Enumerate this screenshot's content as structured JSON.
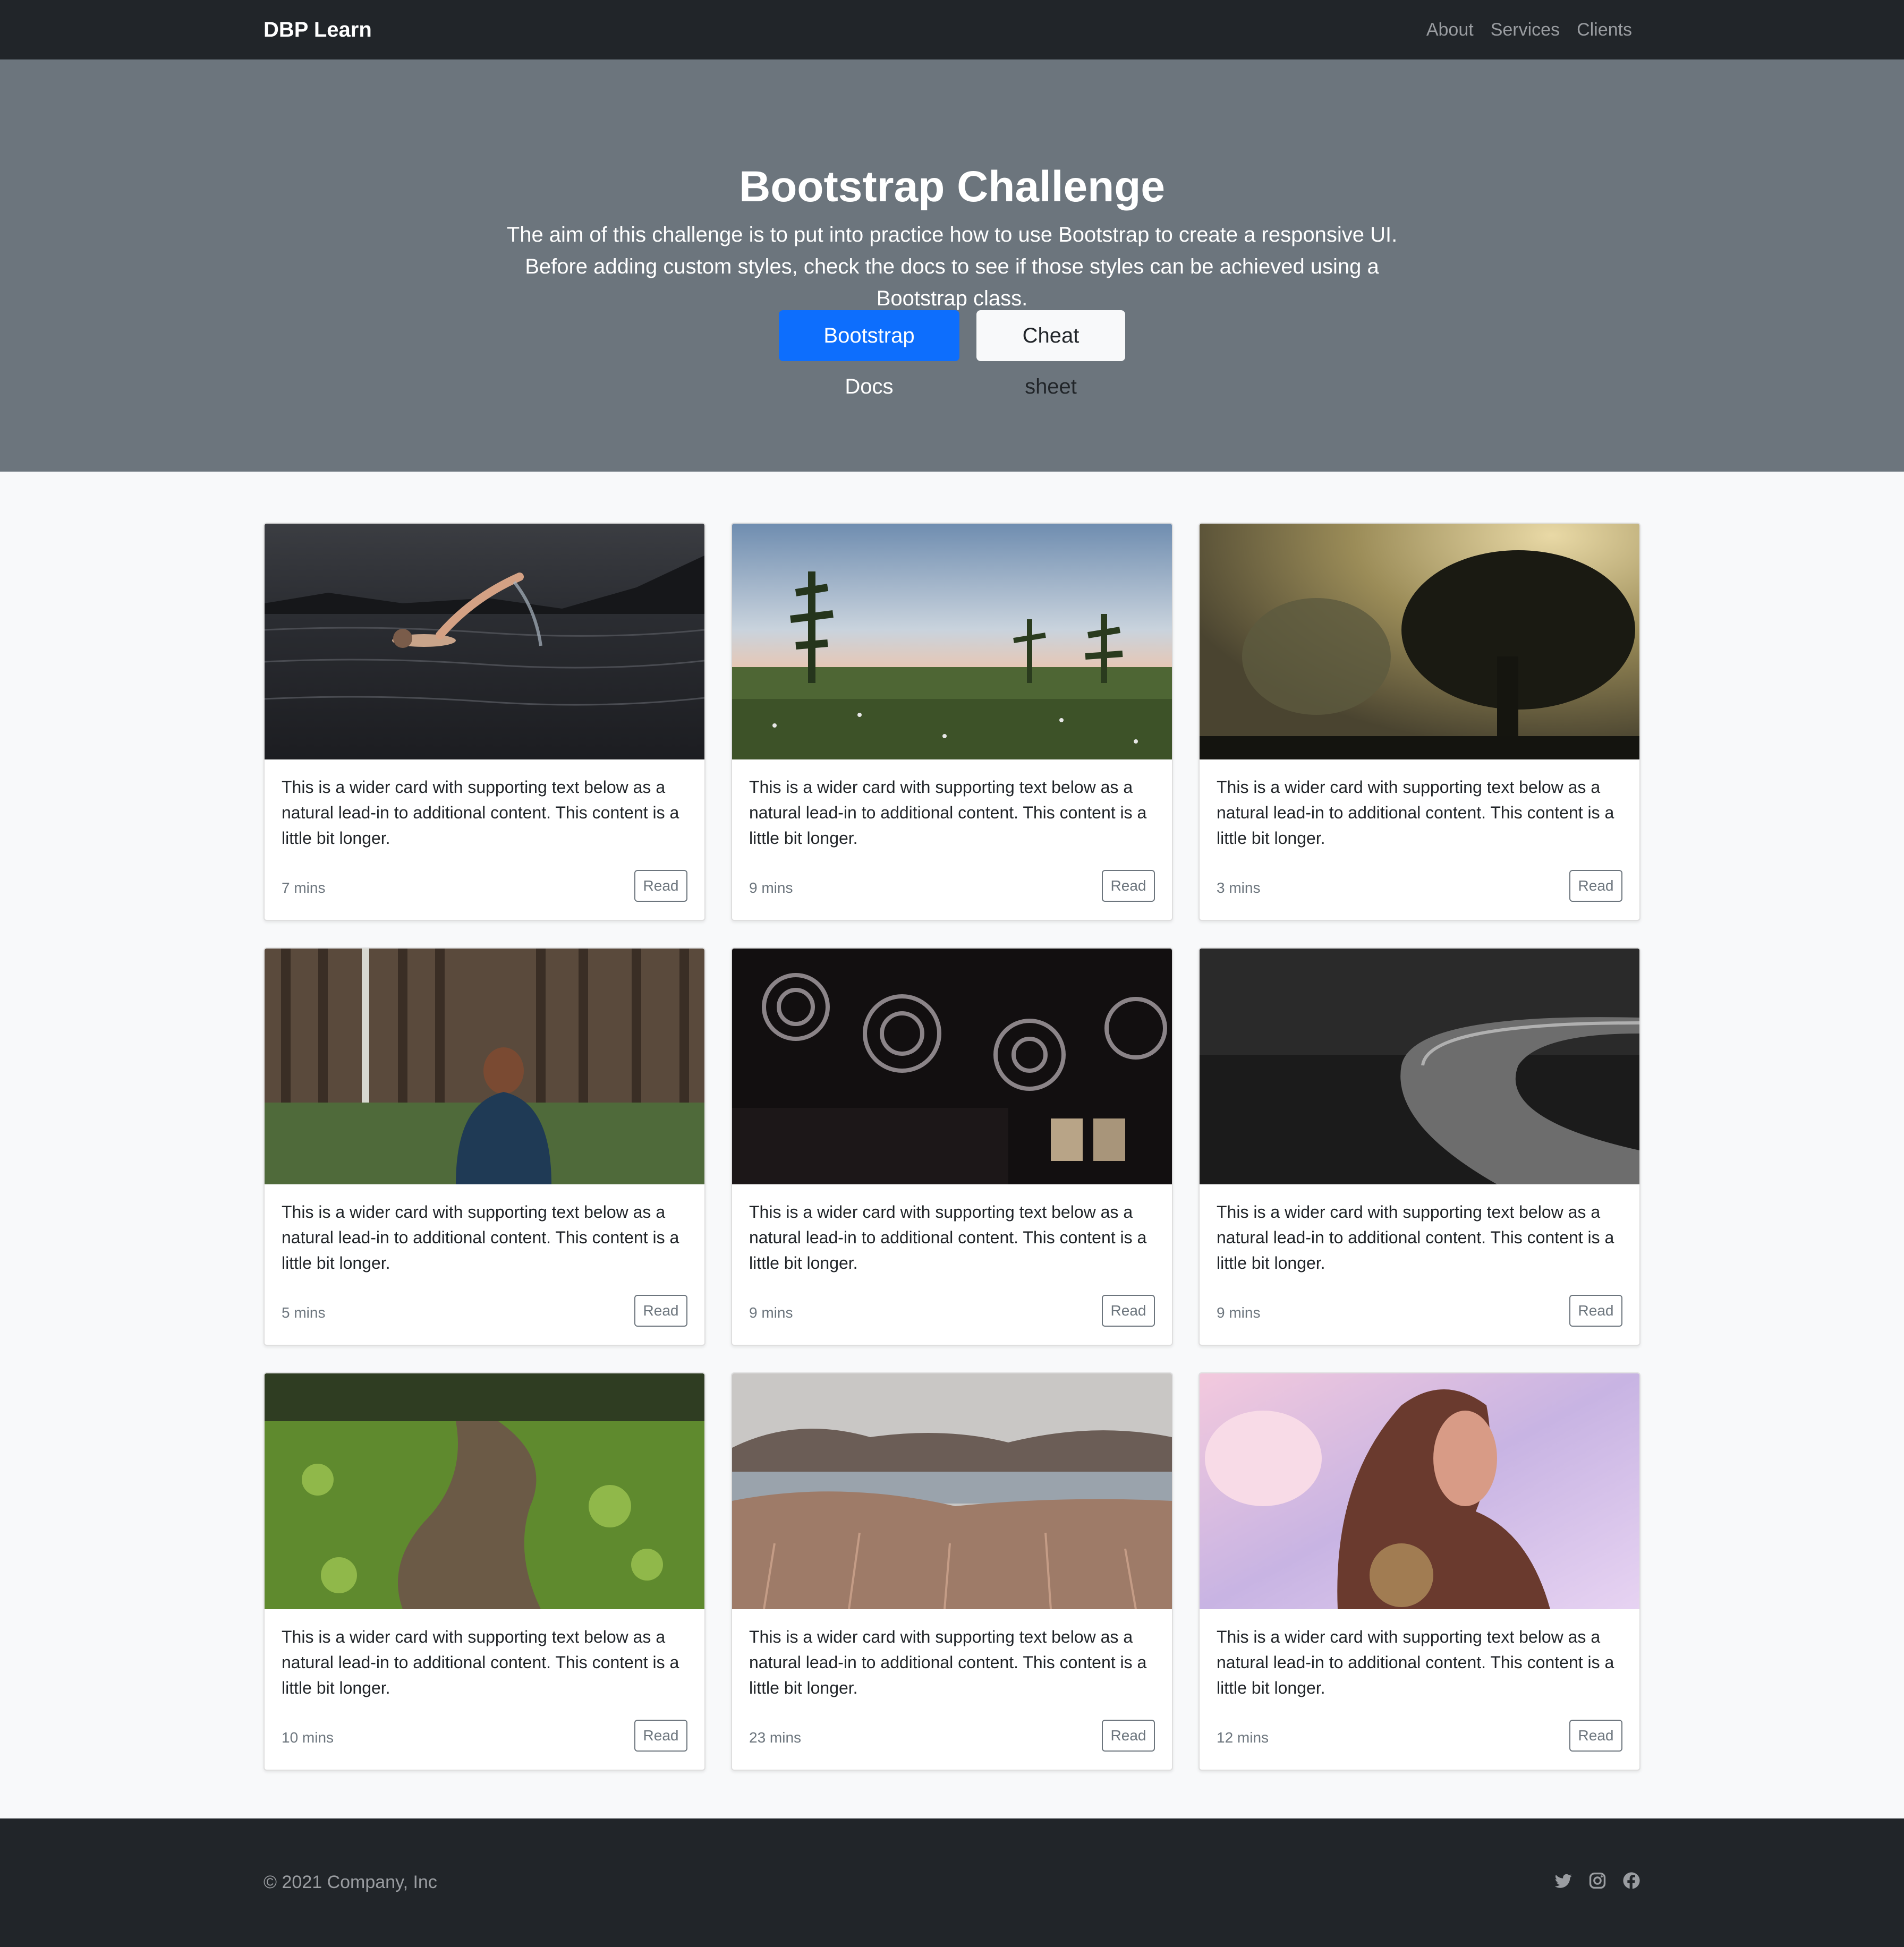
{
  "navbar": {
    "brand": "DBP Learn",
    "links": [
      "About",
      "Services",
      "Clients"
    ]
  },
  "hero": {
    "title": "Bootstrap Challenge",
    "description": "The aim of this challenge is to put into practice how to use Bootstrap to create a responsive UI. Before adding custom styles, check the docs to see if those styles can be achieved using a Bootstrap class.",
    "primary_button": "Bootstrap Docs",
    "secondary_button": "Cheat sheet"
  },
  "cards": [
    {
      "image": "swimmer-in-lake",
      "text": "This is a wider card with supporting text below as a natural lead-in to additional content. This content is a little bit longer.",
      "time": "7 mins",
      "button": "Read"
    },
    {
      "image": "meadow-with-pines",
      "text": "This is a wider card with supporting text below as a natural lead-in to additional content. This content is a little bit longer.",
      "time": "9 mins",
      "button": "Read"
    },
    {
      "image": "foggy-trees",
      "text": "This is a wider card with supporting text below as a natural lead-in to additional content. This content is a little bit longer.",
      "time": "3 mins",
      "button": "Read"
    },
    {
      "image": "person-in-forest",
      "text": "This is a wider card with supporting text below as a natural lead-in to additional content. This content is a little bit longer.",
      "time": "5 mins",
      "button": "Read"
    },
    {
      "image": "vintage-cameras",
      "text": "This is a wider card with supporting text below as a natural lead-in to additional content. This content is a little bit longer.",
      "time": "9 mins",
      "button": "Read"
    },
    {
      "image": "dark-road",
      "text": "This is a wider card with supporting text below as a natural lead-in to additional content. This content is a little bit longer.",
      "time": "9 mins",
      "button": "Read"
    },
    {
      "image": "moss-path",
      "text": "This is a wider card with supporting text below as a natural lead-in to additional content. This content is a little bit longer.",
      "time": "10 mins",
      "button": "Read"
    },
    {
      "image": "lake-hills",
      "text": "This is a wider card with supporting text below as a natural lead-in to additional content. This content is a little bit longer.",
      "time": "23 mins",
      "button": "Read"
    },
    {
      "image": "woman-sunlight",
      "text": "This is a wider card with supporting text below as a natural lead-in to additional content. This content is a little bit longer.",
      "time": "12 mins",
      "button": "Read"
    }
  ],
  "footer": {
    "copyright": "© 2021 Company, Inc",
    "social_icons": [
      "twitter-icon",
      "instagram-icon",
      "facebook-icon"
    ]
  },
  "colors": {
    "navbar": "#212529",
    "hero": "#6c757d",
    "primary": "#0d6efd",
    "page_background": "#f8f9fa"
  }
}
